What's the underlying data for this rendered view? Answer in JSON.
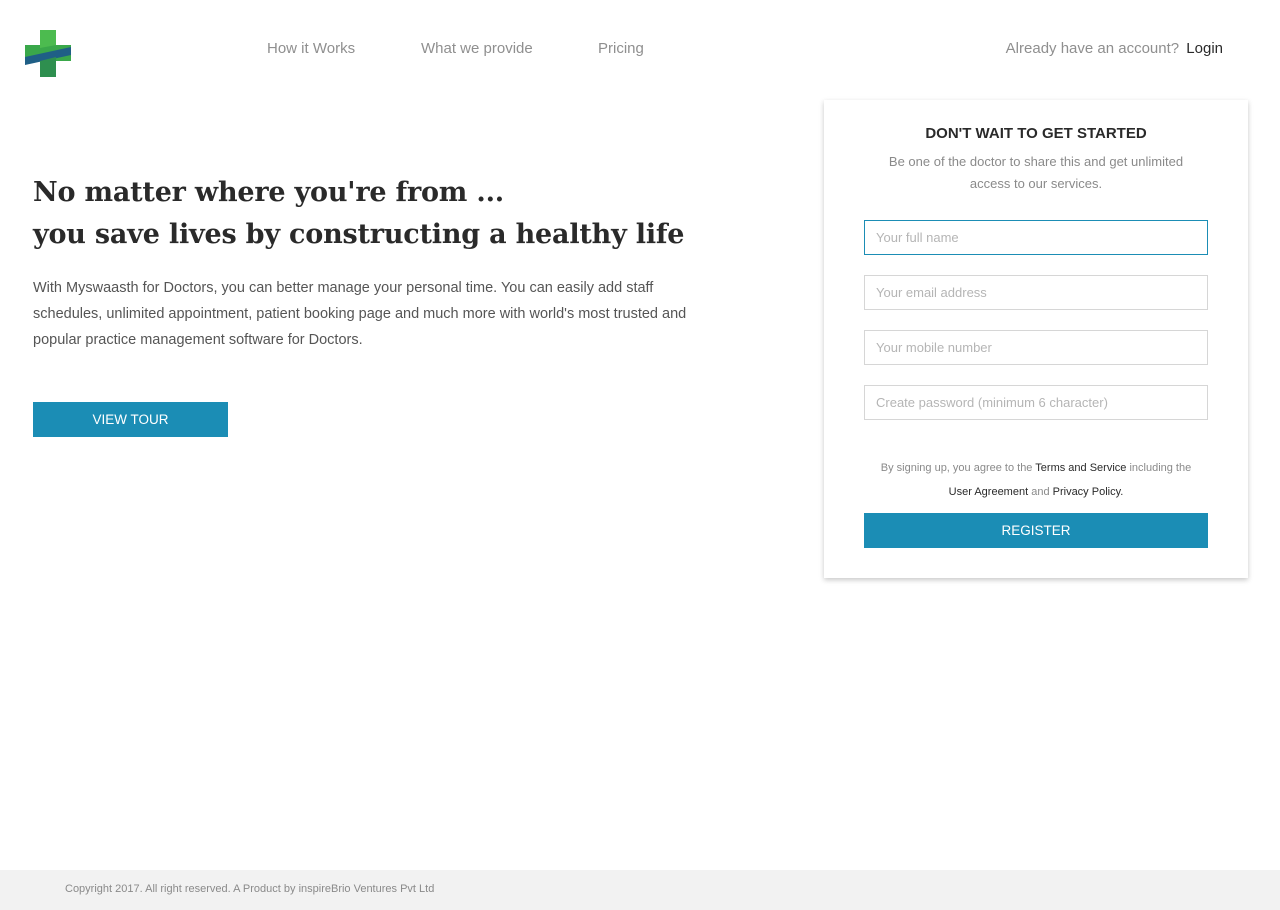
{
  "header": {
    "logo_icon": "medical-cross-icon",
    "nav": [
      "How it Works",
      "What we provide",
      "Pricing"
    ],
    "account_prompt": "Already have an account?",
    "login_label": "Login"
  },
  "hero": {
    "title_line1": "No matter where you're from ...",
    "title_line2": "you save lives by constructing a healthy life",
    "description": "With Myswaasth for Doctors, you can better manage your personal time. You can easily add staff schedules, unlimited appointment, patient booking page and much more with world's most trusted and popular practice management software for Doctors.",
    "view_tour_label": "VIEW TOUR"
  },
  "signup": {
    "title": "DON'T WAIT TO GET STARTED",
    "subtitle": "Be one of the doctor to share this and get unlimited access to our services.",
    "fields": {
      "name_placeholder": "Your full name",
      "email_placeholder": "Your email address",
      "mobile_placeholder": "Your mobile number",
      "password_placeholder": "Create password (minimum 6 character)"
    },
    "agree_prefix": "By signing up, you agree to the",
    "terms_label": "Terms and Service",
    "agree_mid": "including the",
    "user_agreement_label": "User Agreement",
    "and_text": "and",
    "privacy_label": "Privacy Policy.",
    "register_label": "REGISTER"
  },
  "footer": {
    "copyright": "Copyright 2017. All right reserved. A Product by inspireBrio Ventures Pvt Ltd"
  },
  "colors": {
    "accent": "#1b8db5",
    "logo_green": "#3aa84a",
    "logo_dark": "#1f5f86"
  }
}
